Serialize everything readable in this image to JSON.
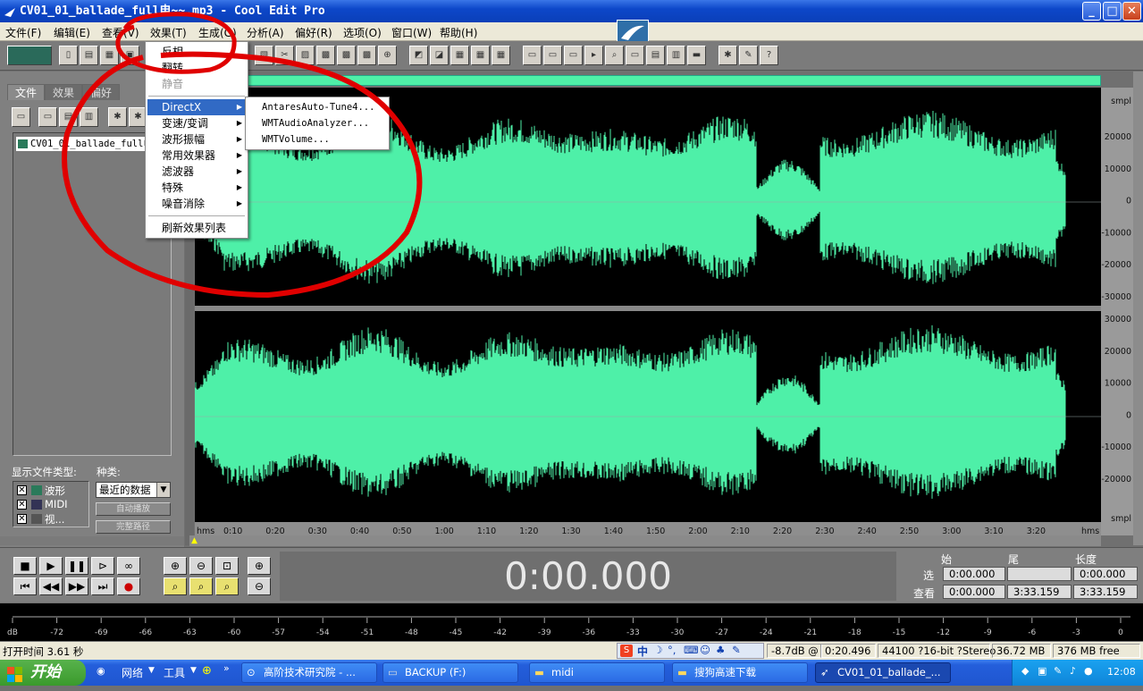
{
  "window": {
    "title": "CV01_01_ballade_full电~~.mp3 - Cool Edit Pro",
    "minimize": "_",
    "maximize": "□",
    "close": "✕"
  },
  "menubar": {
    "items": [
      "文件(F)",
      "编辑(E)",
      "查看(V)",
      "效果(T)",
      "生成(G)",
      "分析(A)",
      "偏好(R)",
      "选项(O)",
      "窗口(W)",
      "帮助(H)"
    ]
  },
  "effects_menu": {
    "items": [
      "反相",
      "翻转",
      "静音"
    ],
    "disabled_item": "静音",
    "submenus": [
      "DirectX",
      "变速/变调",
      "波形振幅",
      "常用效果器",
      "滤波器",
      "特殊",
      "噪音消除"
    ],
    "refresh": "刷新效果列表"
  },
  "directx_submenu": {
    "items": [
      "AntaresAuto-Tune4...",
      "WMTAudioAnalyzer...",
      "WMTVolume..."
    ]
  },
  "left_panel": {
    "tabs": [
      "文件",
      "效果",
      "偏好"
    ],
    "file_item": "CV01_01_ballade_full电~~.mp3",
    "display_type_label": "显示文件类型:",
    "kind_label": "种类:",
    "kind_value": "最近的数据",
    "types": [
      "波形",
      "MIDI",
      "视..."
    ],
    "autoplay": "自动播放",
    "full_path": "完整路径"
  },
  "waveform": {
    "unit_top": "smpl",
    "unit_bottom": "smpl",
    "y_ticks_ch1": [
      "20000",
      "10000",
      "0",
      "-10000",
      "-20000",
      "-30000"
    ],
    "y_ticks_ch2": [
      "30000",
      "20000",
      "10000",
      "0",
      "-10000",
      "-20000"
    ],
    "time_ticks": [
      "hms",
      "0:10",
      "0:20",
      "0:30",
      "0:40",
      "0:50",
      "1:00",
      "1:10",
      "1:20",
      "1:30",
      "1:40",
      "1:50",
      "2:00",
      "2:10",
      "2:20",
      "2:30",
      "2:40",
      "2:50",
      "3:00",
      "3:10",
      "3:20",
      "hms"
    ],
    "color": "#4ef0a8"
  },
  "transport": {
    "time": "0:00.000",
    "col_start": "始",
    "col_end": "尾",
    "col_length": "长度",
    "row_sel": "选",
    "row_view": "查看",
    "sel_start": "0:00.000",
    "sel_end": "",
    "sel_length": "0:00.000",
    "view_start": "0:00.000",
    "view_end": "3:33.159",
    "view_length": "3:33.159"
  },
  "level_meter": {
    "ticks": [
      "dB",
      "-72",
      "-69",
      "-66",
      "-63",
      "-60",
      "-57",
      "-54",
      "-51",
      "-48",
      "-45",
      "-42",
      "-39",
      "-36",
      "-33",
      "-30",
      "-27",
      "-24",
      "-21",
      "-18",
      "-15",
      "-12",
      "-9",
      "-6",
      "-3",
      "0"
    ]
  },
  "status": {
    "open_time": "打开时间  3.61 秒",
    "level": "-8.7dB @",
    "pos": "0:20.496",
    "format": "44100 ?16-bit ?Stereo",
    "size": "36.72 MB",
    "free": "376 MB free",
    "ime": "中"
  },
  "taskbar": {
    "start": "开始",
    "network": "网络",
    "tools": "工具",
    "tasks": [
      "高阶技术研究院 - ...",
      "BACKUP  (F:)",
      "midi",
      "搜狗高速下载",
      "CV01_01_ballade_..."
    ],
    "clock": "12:08"
  },
  "annotation_color": "#e00000"
}
